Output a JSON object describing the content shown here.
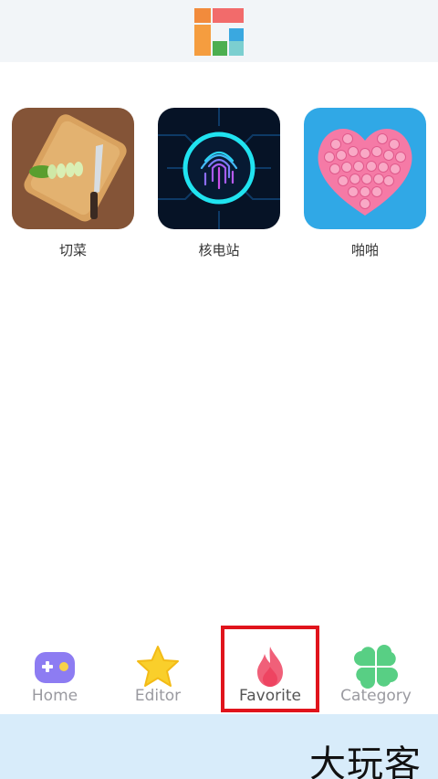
{
  "header": {
    "logo_icon": "app-logo-icon",
    "logo_colors": [
      "#f28b3c",
      "#f26b6b",
      "#4caf50",
      "#7ccfd0",
      "#3aa8e0"
    ]
  },
  "games": [
    {
      "name": "切菜",
      "icon": "vegetable-cutting-thumbnail"
    },
    {
      "name": "核电站",
      "icon": "fingerprint-thumbnail"
    },
    {
      "name": "啪啪",
      "icon": "pop-it-heart-thumbnail"
    }
  ],
  "tabbar": {
    "tabs": [
      {
        "label": "Home",
        "icon": "gamepad-icon"
      },
      {
        "label": "Editor",
        "icon": "star-icon"
      },
      {
        "label": "Favorite",
        "icon": "flame-icon",
        "active": true
      },
      {
        "label": "Category",
        "icon": "clover-icon"
      }
    ],
    "highlight_color": "#e0141c"
  },
  "watermark": {
    "text": "大玩客"
  }
}
